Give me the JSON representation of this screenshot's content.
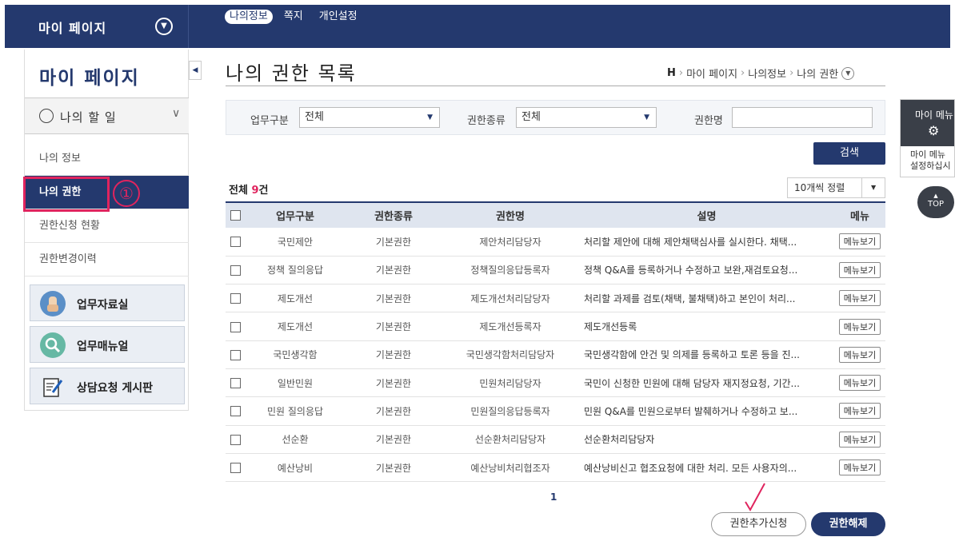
{
  "topbar": {
    "title": "마이 페이지",
    "tabs": [
      {
        "label": "나의정보"
      },
      {
        "label": "쪽지"
      },
      {
        "label": "개인설정"
      }
    ]
  },
  "sidebar": {
    "title": "마이 페이지",
    "todo_label": "나의 할 일",
    "items": [
      {
        "label": "나의 정보"
      },
      {
        "label": "나의 권한"
      },
      {
        "label": "권한신청 현황"
      },
      {
        "label": "권한변경이력"
      }
    ],
    "cards": [
      {
        "label": "업무자료실"
      },
      {
        "label": "업무매뉴얼"
      },
      {
        "label": "상담요청 게시판"
      }
    ],
    "annotation_number": "①"
  },
  "page": {
    "title": "나의 권한 목록",
    "breadcrumb": [
      "H",
      "마이 페이지",
      "나의정보",
      "나의 권한"
    ]
  },
  "filter": {
    "work_label": "업무구분",
    "work_value": "전체",
    "type_label": "권한종류",
    "type_value": "전체",
    "name_label": "권한명",
    "name_value": "",
    "search_label": "검색"
  },
  "list": {
    "total_prefix": "전체",
    "total_count": "9",
    "total_suffix": "건",
    "sort_label": "10개씩 정렬",
    "headers": [
      "업무구분",
      "권한종류",
      "권한명",
      "설명",
      "메뉴"
    ],
    "rows": [
      {
        "work": "국민제안",
        "type": "기본권한",
        "name": "제안처리담당자",
        "desc": "처리할 제안에 대해 제안채택심사를 실시한다. 채택...",
        "menu": "메뉴보기"
      },
      {
        "work": "정책 질의응답",
        "type": "기본권한",
        "name": "정책질의응답등록자",
        "desc": "정책 Q&A를 등록하거나 수정하고 보완,재검토요청...",
        "menu": "메뉴보기"
      },
      {
        "work": "제도개선",
        "type": "기본권한",
        "name": "제도개선처리담당자",
        "desc": "처리할 과제를 검토(채택, 불채택)하고 본인이 처리...",
        "menu": "메뉴보기"
      },
      {
        "work": "제도개선",
        "type": "기본권한",
        "name": "제도개선등록자",
        "desc": "제도개선등록",
        "menu": "메뉴보기"
      },
      {
        "work": "국민생각함",
        "type": "기본권한",
        "name": "국민생각함처리담당자",
        "desc": "국민생각함에 안건 및 의제를 등록하고 토론 등을 진...",
        "menu": "메뉴보기"
      },
      {
        "work": "일반민원",
        "type": "기본권한",
        "name": "민원처리담당자",
        "desc": "국민이 신청한 민원에 대해 담당자 재지정요청, 기간...",
        "menu": "메뉴보기"
      },
      {
        "work": "민원 질의응답",
        "type": "기본권한",
        "name": "민원질의응답등록자",
        "desc": "민원 Q&A를 민원으로부터 발췌하거나 수정하고 보...",
        "menu": "메뉴보기"
      },
      {
        "work": "선순환",
        "type": "기본권한",
        "name": "선순환처리담당자",
        "desc": "선순환처리담당자",
        "menu": "메뉴보기"
      },
      {
        "work": "예산낭비",
        "type": "기본권한",
        "name": "예산낭비처리협조자",
        "desc": "예산낭비신고 협조요청에 대한 처리. 모든 사용자의...",
        "menu": "메뉴보기"
      }
    ],
    "page_number": "1"
  },
  "actions": {
    "add_label": "권한추가신청",
    "release_label": "권한해제"
  },
  "right_panel": {
    "mymenu_title": "마이 메뉴",
    "mymenu_sub1": "마이 메뉴",
    "mymenu_sub2": "설정하십시",
    "top_label": "TOP"
  },
  "colors": {
    "primary": "#24396e",
    "highlight": "#e0245e"
  }
}
